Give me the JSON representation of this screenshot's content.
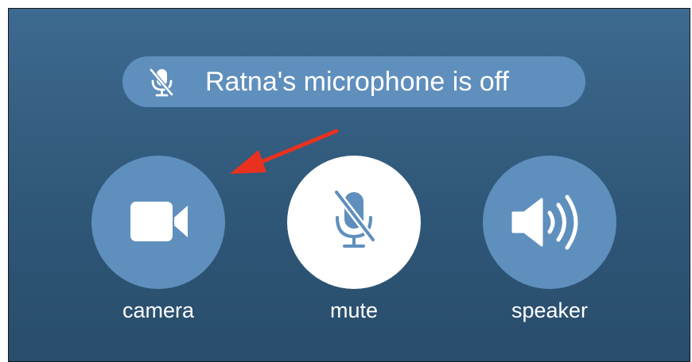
{
  "banner": {
    "icon": "microphone-slash-icon",
    "text": "Ratna's microphone is off"
  },
  "controls": [
    {
      "id": "camera",
      "icon": "video-camera-icon",
      "label": "camera",
      "active": false
    },
    {
      "id": "mute",
      "icon": "microphone-slash-icon",
      "label": "mute",
      "active": true
    },
    {
      "id": "speaker",
      "icon": "speaker-icon",
      "label": "speaker",
      "active": false
    }
  ],
  "annotation": {
    "icon": "red-arrow-icon",
    "points_to": "camera",
    "color": "#e8321f"
  },
  "colors": {
    "background_top": "#3d6a90",
    "background_bottom": "#294d6c",
    "button": "#5f8fbd",
    "button_active": "#ffffff",
    "icon_on_active": "#5f8fbd",
    "text": "#ffffff"
  }
}
